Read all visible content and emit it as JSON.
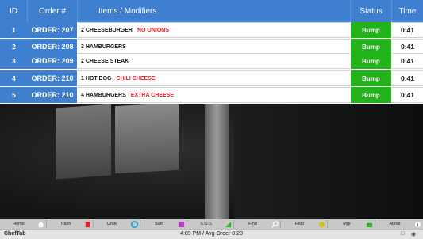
{
  "header": {
    "id_label": "ID",
    "order_label": "Order #",
    "items_label": "Items / Modifiers",
    "status_label": "Status",
    "time_label": "Time"
  },
  "orders": [
    {
      "id": "1",
      "order": "ORDER:  207",
      "item": "2 CHEESEBURGER",
      "modifiers": "NO ONIONS",
      "status": "Bump",
      "time": "0:41"
    },
    {
      "id": "2",
      "order": "ORDER:  208",
      "item": "3 HAMBURGERS",
      "modifiers": "",
      "status": "Bump",
      "time": "0:41"
    },
    {
      "id": "3",
      "order": "ORDER:  209",
      "item": "2 CHEESE STEAK",
      "modifiers": "",
      "status": "Bump",
      "time": "0:41"
    },
    {
      "id": "4",
      "order": "ORDER:  210",
      "item": "1 HOT DOG",
      "modifiers": "CHILI    CHEESE",
      "status": "Bump",
      "time": "0:41"
    },
    {
      "id": "5",
      "order": "ORDER:  210",
      "item": "4 HAMBURGERS",
      "modifiers": "EXTRA CHEESE",
      "status": "Bump",
      "time": "0:41"
    }
  ],
  "toolbar": {
    "buttons": [
      {
        "label": "Home",
        "icon": "house-icon",
        "color": "#ffffff"
      },
      {
        "label": "Trash",
        "icon": "trash-icon",
        "color": "#e02222"
      },
      {
        "label": "Undo",
        "icon": "undo-icon",
        "color": "#1aa6d6"
      },
      {
        "label": "Sum",
        "icon": "sum-icon",
        "color": "#b83ac8"
      },
      {
        "label": "S.O.S",
        "icon": "sos-icon",
        "color": "#33b52a"
      },
      {
        "label": "Find",
        "icon": "magnifier-icon",
        "color": "#ffffff"
      },
      {
        "label": "Help",
        "icon": "help-icon",
        "color": "#d6c21a"
      },
      {
        "label": "Mgr",
        "icon": "manager-icon",
        "color": "#2fb02a"
      },
      {
        "label": "About",
        "icon": "info-icon",
        "color": "#ffffff"
      }
    ]
  },
  "status_bar": {
    "app_name": "ChefTab",
    "clock_text": "4:09 PM / Avg Order 0:20"
  },
  "colors": {
    "header_blue": "#3f7fd0",
    "bump_green": "#22b219",
    "modifier_red": "#e0202a"
  }
}
